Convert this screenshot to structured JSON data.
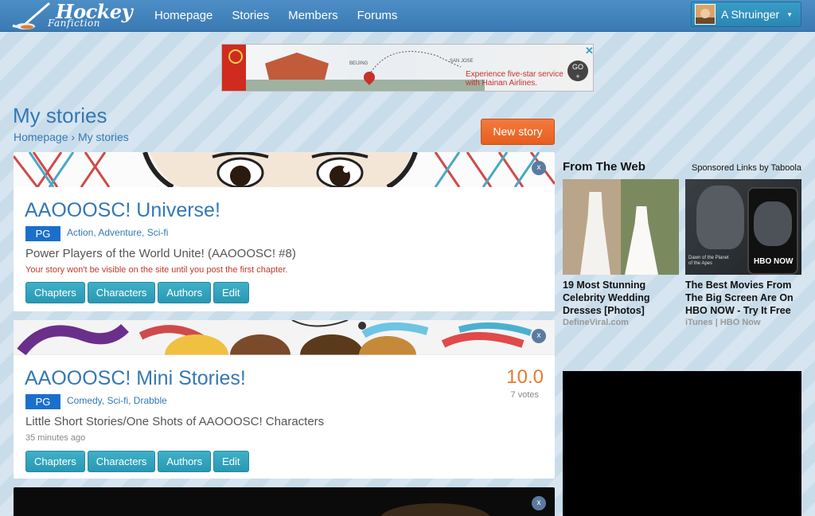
{
  "navbar": {
    "logo_main": "Hockey",
    "logo_sub": "Fanfiction",
    "links": [
      {
        "label": "Homepage"
      },
      {
        "label": "Stories"
      },
      {
        "label": "Members"
      },
      {
        "label": "Forums"
      }
    ],
    "user_name": "A Shruinger"
  },
  "ad": {
    "text": "Experience five-star service with Hainan Airlines.",
    "city_from": "BEIJING",
    "city_to": "SAN JOSE",
    "go_label": "GO",
    "close_label": "✕"
  },
  "page": {
    "title": "My stories",
    "breadcrumb_home": "Homepage",
    "breadcrumb_sep": "›",
    "breadcrumb_current": "My stories",
    "new_story_label": "New story"
  },
  "stories": [
    {
      "title": "AAOOOSC! Universe!",
      "rating": "PG",
      "genres": "Action, Adventure, Sci-fi",
      "summary": "Power Players of the World Unite! (AAOOOSC! #8)",
      "notice": "Your story won't be visible on the site until you post the first chapter.",
      "buttons": [
        "Chapters",
        "Characters",
        "Authors",
        "Edit"
      ],
      "close": "x"
    },
    {
      "title": "AAOOOSC! Mini Stories!",
      "rating": "PG",
      "genres": "Comedy, Sci-fi, Drabble",
      "summary": "Little Short Stories/One Shots of AAOOOSC! Characters",
      "timestamp": "35 minutes ago",
      "score": "10.0",
      "votes": "7 votes",
      "buttons": [
        "Chapters",
        "Characters",
        "Authors",
        "Edit"
      ],
      "close": "x"
    },
    {
      "close": "x"
    }
  ],
  "taboola": {
    "header": "From The Web",
    "sponsor": "Sponsored Links by Taboola",
    "items": [
      {
        "title": "19 Most Stunning Celebrity Wedding Dresses [Photos]",
        "source": "DefineViral.com"
      },
      {
        "title": "The Best Movies From The Big Screen Are On HBO NOW - Try It Free",
        "source": "iTunes | HBO Now",
        "thumb_caption": "Dawn of the Planet of the Apes",
        "thumb_logo": "HBO NOW"
      }
    ]
  },
  "colors": {
    "nav": "#3a7ab4",
    "link": "#3478b5",
    "accent_orange": "#e55f1f",
    "button_teal": "#2a98b3",
    "rating_blue": "#1b6fcc",
    "notice_red": "#c0392b",
    "score_orange": "#e27b2e"
  }
}
